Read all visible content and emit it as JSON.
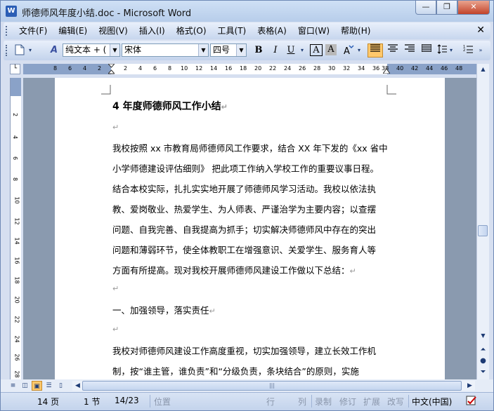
{
  "window": {
    "title": "师德师风年度小结.doc - Microsoft Word",
    "app_icon": "W",
    "controls": {
      "minimize": "—",
      "restore": "❐",
      "close": "✕"
    }
  },
  "menu": {
    "items": [
      "文件(F)",
      "编辑(E)",
      "视图(V)",
      "插入(I)",
      "格式(O)",
      "工具(T)",
      "表格(A)",
      "窗口(W)",
      "帮助(H)"
    ],
    "close_glyph": "✕"
  },
  "toolbar": {
    "style_value": "纯文本 + (",
    "font_value": "宋体",
    "size_value": "四号",
    "bold": "B",
    "italic": "I",
    "underline": "U",
    "char_border": "A",
    "char_shade": "A"
  },
  "ruler": {
    "left_numbers": [
      "8",
      "6",
      "4",
      "2"
    ],
    "right_numbers": [
      "2",
      "4",
      "6",
      "8",
      "10",
      "12",
      "14",
      "16",
      "18",
      "20",
      "22",
      "24",
      "26",
      "28",
      "30",
      "32",
      "34",
      "36",
      "38",
      "40",
      "42",
      "44",
      "46",
      "48"
    ],
    "vertical_numbers": [
      "2",
      "4",
      "6",
      "8",
      "10",
      "12",
      "14",
      "16",
      "18",
      "20",
      "22",
      "24",
      "26",
      "28"
    ]
  },
  "document": {
    "title": "4 年度师德师风工作小结",
    "lines": [
      "",
      "我校按照 xx 市教育局师德师风工作要求，结合 XX 年下发的《xx 省中",
      "小学师德建设评估细则》 把此项工作纳入学校工作的重要议事日程。",
      "结合本校实际，扎扎实实地开展了师德师风学习活动。我校以依法执",
      "教、爱岗敬业、热爱学生、为人师表、严谨治学为主要内容；以查摆",
      "问题、自我完善、自我提高为抓手；切实解决师德师风中存在的突出",
      "问题和薄弱环节，使全体教职工在增强意识、关爱学生、服务育人等",
      "方面有所提高。现对我校开展师德师风建设工作做以下总结：",
      "",
      "一、加强领导，落实责任",
      "",
      "我校对师德师风建设工作高度重视，切实加强领导，建立长效工作机",
      "制，按“谁主管，谁负责”和“分级负责，条块结合”的原则，实施"
    ],
    "para_marks": [
      true,
      false,
      false,
      false,
      false,
      false,
      false,
      true,
      true,
      true,
      true,
      false,
      false
    ],
    "para_mark_glyph": "↵"
  },
  "statusbar": {
    "page": "14 页",
    "section": "1 节",
    "page_of": "14/23",
    "position": "位置",
    "line": "行",
    "column": "列",
    "rec": "录制",
    "trk": "修订",
    "ext": "扩展",
    "ovr": "改写",
    "language": "中文(中国)"
  }
}
